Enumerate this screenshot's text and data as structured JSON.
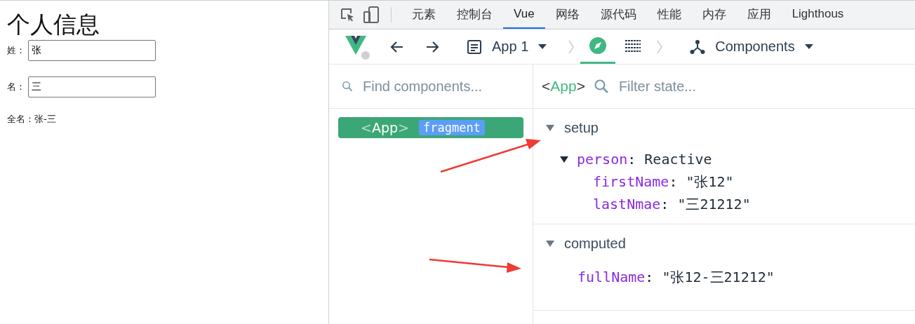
{
  "page": {
    "title": "个人信息",
    "fields": [
      {
        "label": "姓：",
        "value": "张"
      },
      {
        "label": "名：",
        "value": "三"
      }
    ],
    "full_name": "全名：张-三"
  },
  "devtools": {
    "tabs": [
      {
        "label": "元素",
        "selected": false
      },
      {
        "label": "控制台",
        "selected": false
      },
      {
        "label": "Vue",
        "selected": true
      },
      {
        "label": "网络",
        "selected": false
      },
      {
        "label": "源代码",
        "selected": false
      },
      {
        "label": "性能",
        "selected": false
      },
      {
        "label": "内存",
        "selected": false
      },
      {
        "label": "应用",
        "selected": false
      },
      {
        "label": "Lighthous",
        "selected": false
      }
    ],
    "toolbar": {
      "app": "App 1",
      "views": [
        {
          "kind": "inspector",
          "selected": true
        },
        {
          "kind": "timeline",
          "selected": false
        }
      ],
      "mode": "Components"
    },
    "tree": {
      "placeholder": "Find components...",
      "items": [
        {
          "open": "<",
          "name": "App",
          "close": ">",
          "badge": "fragment",
          "selected": true
        }
      ]
    },
    "inspector": {
      "open": "<",
      "component": "App",
      "close": ">",
      "placeholder": "Filter state...",
      "sections": [
        {
          "title": "setup",
          "expanded": true,
          "items": [
            {
              "key": "person",
              "sep": ":",
              "value": "Reactive",
              "expanded": true,
              "children": [
                {
                  "key": "firstName",
                  "sep": ":",
                  "value": "\"张12\""
                },
                {
                  "key": "lastNmae",
                  "sep": ":",
                  "value": "\"三21212\""
                }
              ]
            }
          ]
        },
        {
          "title": "computed",
          "expanded": true,
          "items": [
            {
              "key": "fullName",
              "sep": ":",
              "value": "\"张12-三21212\""
            }
          ]
        }
      ]
    }
  }
}
